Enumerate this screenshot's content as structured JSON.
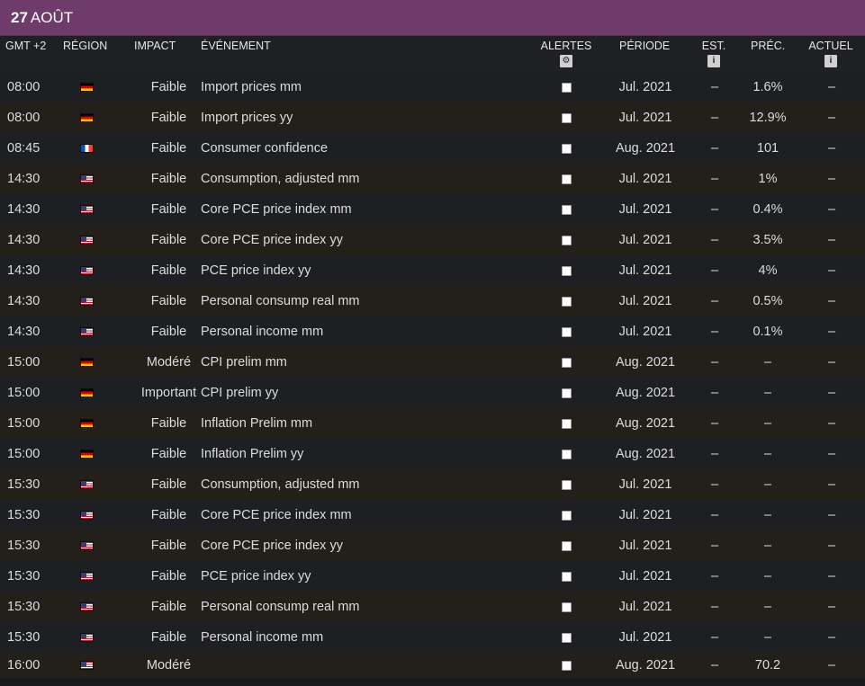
{
  "banner": {
    "day": "27",
    "month": "AOÛT"
  },
  "header": {
    "time": "GMT +2",
    "region": "RÉGION",
    "impact": "IMPACT",
    "event": "ÉVÉNEMENT",
    "alerts": "ALERTES",
    "alerts_icon": "gear-icon",
    "alerts_icon_glyph": "⚙",
    "period": "PÉRIODE",
    "est": "EST.",
    "est_icon": "info-icon",
    "est_icon_glyph": "i",
    "prev": "PRÉC.",
    "prev_icon": "info-icon",
    "prev_icon_glyph": "i",
    "actual": "ACTUEL",
    "actual_icon": "info-icon",
    "actual_icon_glyph": "i"
  },
  "rows": [
    {
      "time": "08:00",
      "region": "de",
      "impact": "Faible",
      "event": "Import prices mm",
      "period": "Jul. 2021",
      "est": "–",
      "prev": "1.6%",
      "actual": "–"
    },
    {
      "time": "08:00",
      "region": "de",
      "impact": "Faible",
      "event": "Import prices yy",
      "period": "Jul. 2021",
      "est": "–",
      "prev": "12.9%",
      "actual": "–"
    },
    {
      "time": "08:45",
      "region": "fr",
      "impact": "Faible",
      "event": "Consumer confidence",
      "period": "Aug. 2021",
      "est": "–",
      "prev": "101",
      "actual": "–"
    },
    {
      "time": "14:30",
      "region": "us",
      "impact": "Faible",
      "event": "Consumption, adjusted mm",
      "period": "Jul. 2021",
      "est": "–",
      "prev": "1%",
      "actual": "–"
    },
    {
      "time": "14:30",
      "region": "us",
      "impact": "Faible",
      "event": "Core PCE price index mm",
      "period": "Jul. 2021",
      "est": "–",
      "prev": "0.4%",
      "actual": "–"
    },
    {
      "time": "14:30",
      "region": "us",
      "impact": "Faible",
      "event": "Core PCE price index yy",
      "period": "Jul. 2021",
      "est": "–",
      "prev": "3.5%",
      "actual": "–"
    },
    {
      "time": "14:30",
      "region": "us",
      "impact": "Faible",
      "event": "PCE price index yy",
      "period": "Jul. 2021",
      "est": "–",
      "prev": "4%",
      "actual": "–"
    },
    {
      "time": "14:30",
      "region": "us",
      "impact": "Faible",
      "event": "Personal consump real mm",
      "period": "Jul. 2021",
      "est": "–",
      "prev": "0.5%",
      "actual": "–"
    },
    {
      "time": "14:30",
      "region": "us",
      "impact": "Faible",
      "event": "Personal income mm",
      "period": "Jul. 2021",
      "est": "–",
      "prev": "0.1%",
      "actual": "–"
    },
    {
      "time": "15:00",
      "region": "de",
      "impact": "Modéré",
      "event": "CPI prelim mm",
      "period": "Aug. 2021",
      "est": "–",
      "prev": "–",
      "actual": "–"
    },
    {
      "time": "15:00",
      "region": "de",
      "impact": "Important",
      "event": "CPI prelim yy",
      "period": "Aug. 2021",
      "est": "–",
      "prev": "–",
      "actual": "–"
    },
    {
      "time": "15:00",
      "region": "de",
      "impact": "Faible",
      "event": "Inflation Prelim mm",
      "period": "Aug. 2021",
      "est": "–",
      "prev": "–",
      "actual": "–"
    },
    {
      "time": "15:00",
      "region": "de",
      "impact": "Faible",
      "event": "Inflation Prelim yy",
      "period": "Aug. 2021",
      "est": "–",
      "prev": "–",
      "actual": "–"
    },
    {
      "time": "15:30",
      "region": "us",
      "impact": "Faible",
      "event": "Consumption, adjusted mm",
      "period": "Jul. 2021",
      "est": "–",
      "prev": "–",
      "actual": "–"
    },
    {
      "time": "15:30",
      "region": "us",
      "impact": "Faible",
      "event": "Core PCE price index mm",
      "period": "Jul. 2021",
      "est": "–",
      "prev": "–",
      "actual": "–"
    },
    {
      "time": "15:30",
      "region": "us",
      "impact": "Faible",
      "event": "Core PCE price index yy",
      "period": "Jul. 2021",
      "est": "–",
      "prev": "–",
      "actual": "–"
    },
    {
      "time": "15:30",
      "region": "us",
      "impact": "Faible",
      "event": "PCE price index yy",
      "period": "Jul. 2021",
      "est": "–",
      "prev": "–",
      "actual": "–"
    },
    {
      "time": "15:30",
      "region": "us",
      "impact": "Faible",
      "event": "Personal consump real mm",
      "period": "Jul. 2021",
      "est": "–",
      "prev": "–",
      "actual": "–"
    },
    {
      "time": "15:30",
      "region": "us",
      "impact": "Faible",
      "event": "Personal income mm",
      "period": "Jul. 2021",
      "est": "–",
      "prev": "–",
      "actual": "–"
    },
    {
      "time": "16:00",
      "region": "us",
      "impact": "Modéré",
      "event": "",
      "period": "Aug. 2021",
      "est": "–",
      "prev": "70.2",
      "actual": "–"
    }
  ],
  "colors": {
    "banner": "#6e3b6a",
    "row_odd": "#1d1f23",
    "row_even": "#222019"
  }
}
